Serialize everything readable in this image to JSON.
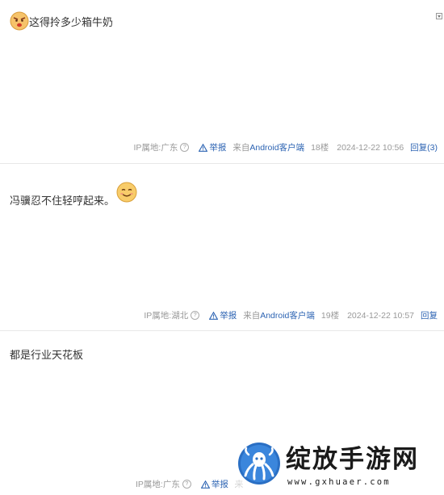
{
  "posts": [
    {
      "content": "这得拎多少箱牛奶",
      "emoji": "angry-face-emoji",
      "ip_label": "IP属地:广东",
      "report_label": "举报",
      "from_label": "来自",
      "client_label": "Android客户端",
      "floor": "18楼",
      "time": "2024-12-22 10:56",
      "reply_label": "回复(3)"
    },
    {
      "content": "冯骥忍不住轻哼起来。",
      "emoji": "smile-face-emoji",
      "ip_label": "IP属地:湖北",
      "report_label": "举报",
      "from_label": "来自",
      "client_label": "Android客户端",
      "floor": "19楼",
      "time": "2024-12-22 10:57",
      "reply_label": "回复"
    },
    {
      "content": "都是行业天花板",
      "ip_label": "IP属地:广东",
      "report_label": "举报",
      "from_label": "来"
    }
  ],
  "watermark": {
    "title": "绽放手游网",
    "url": "www.gxhuaer.com"
  },
  "colors": {
    "link": "#2d64b3",
    "meta": "#999999",
    "divider": "#e8e8e8",
    "text": "#333333"
  }
}
